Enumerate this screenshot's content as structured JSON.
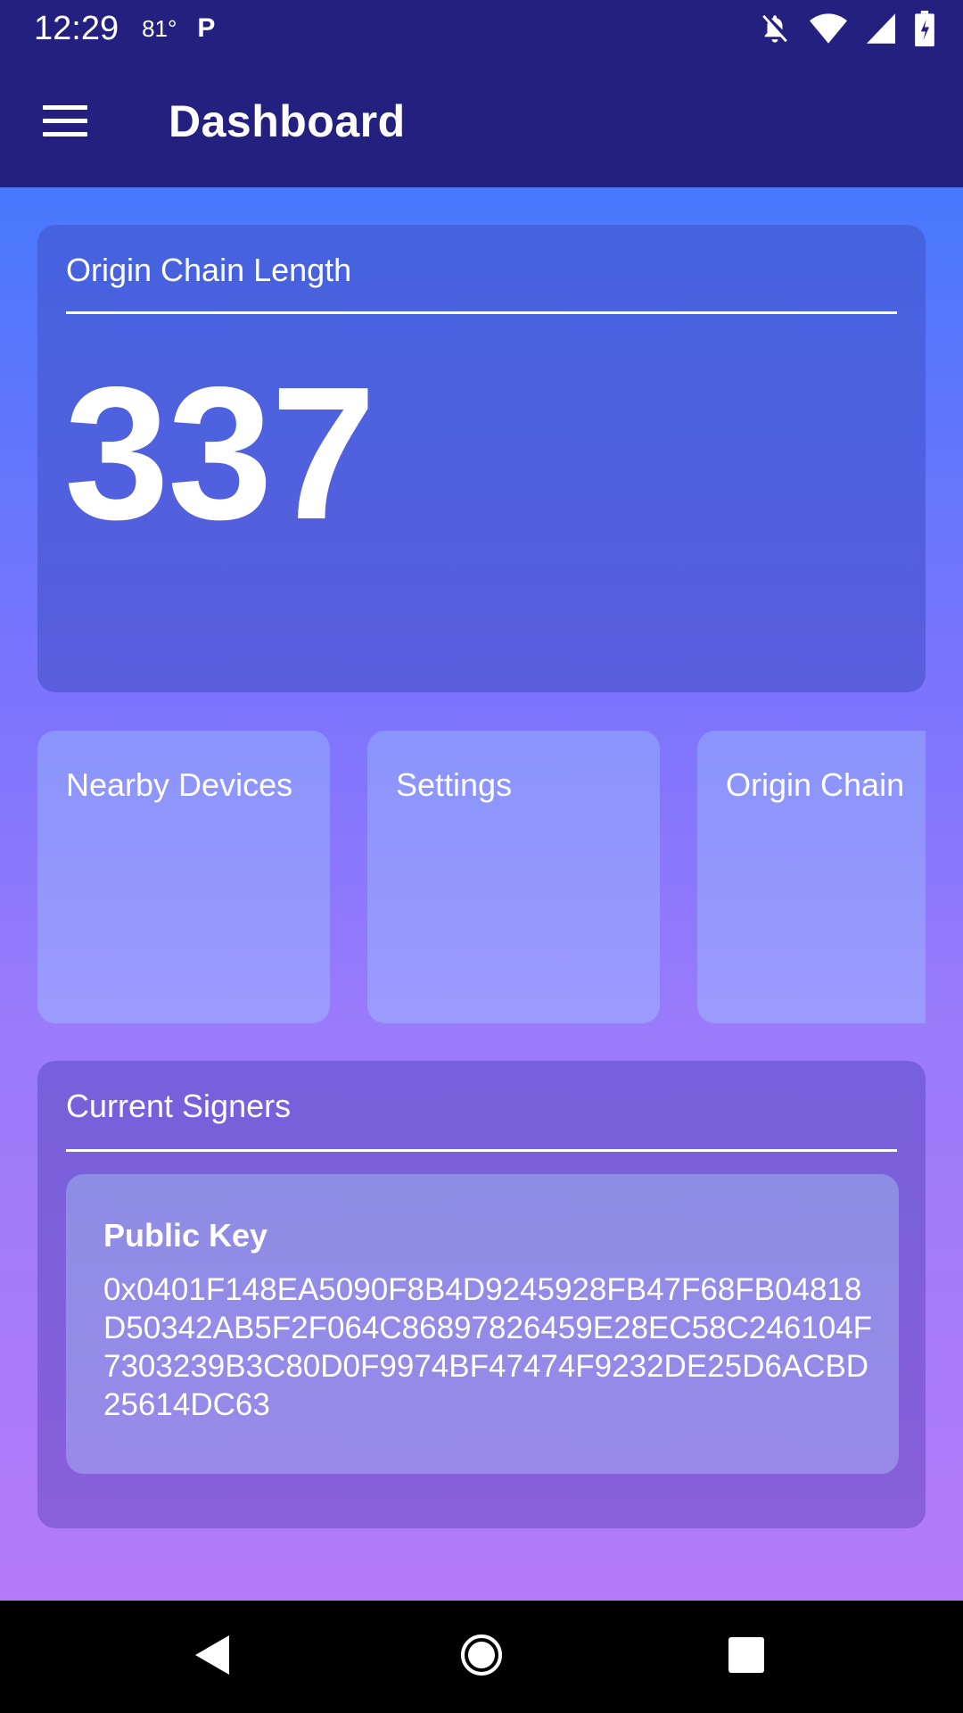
{
  "status_bar": {
    "time": "12:29",
    "temperature": "81°",
    "app_indicator": "P",
    "icons": [
      "notifications-off-icon",
      "wifi-icon",
      "cell-signal-icon",
      "battery-icon"
    ]
  },
  "app_bar": {
    "title": "Dashboard",
    "menu_icon": "hamburger-menu-icon"
  },
  "chain_card": {
    "heading": "Origin Chain Length",
    "value": "337"
  },
  "tiles": [
    {
      "label": "Nearby Devices"
    },
    {
      "label": "Settings"
    },
    {
      "label": "Origin Chain"
    }
  ],
  "signers_card": {
    "heading": "Current Signers",
    "public_key_label": "Public Key",
    "public_key_value": "0x0401F148EA5090F8B4D9245928FB47F68FB04818D50342AB5F2F064C86897826459E28EC58C246104F7303239B3C80D0F9974BF47474F9232DE25D6ACBD25614DC63"
  },
  "nav_bar": {
    "icons": [
      "back-icon",
      "home-icon",
      "recents-icon"
    ]
  },
  "colors": {
    "app_bar": "#232080",
    "gradient_top": "#4778fd",
    "gradient_bottom": "#b37af9"
  }
}
